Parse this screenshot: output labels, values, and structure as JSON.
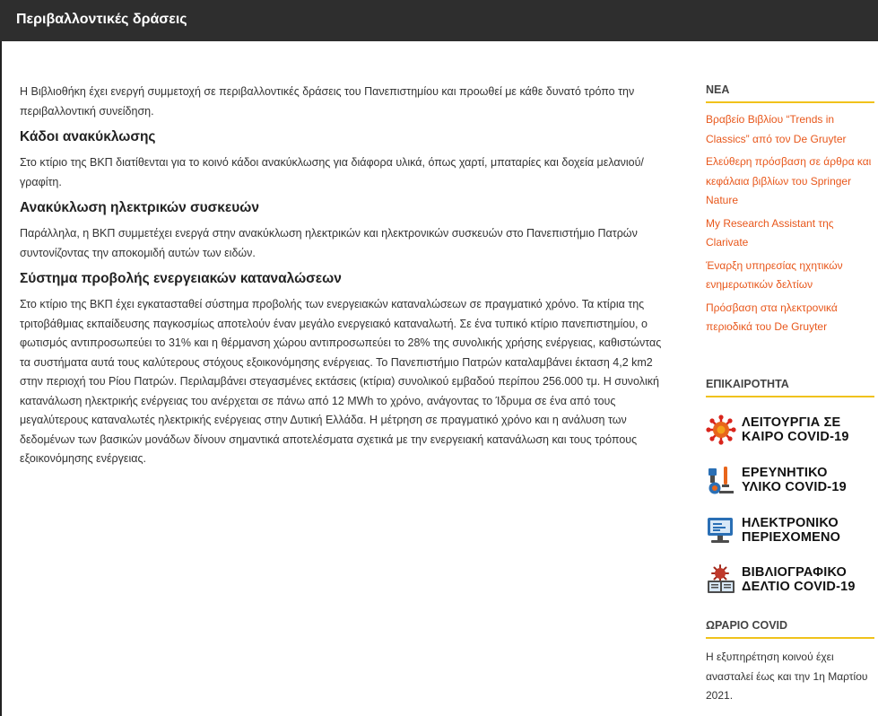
{
  "header": {
    "title": "Περιβαλλοντικές δράσεις"
  },
  "main": {
    "intro": "Η Βιβλιοθήκη έχει ενεργή συμμετοχή σε περιβαλλοντικές δράσεις του Πανεπιστημίου και προωθεί με κάθε δυνατό τρόπο την περιβαλλοντική συνείδηση.",
    "sections": [
      {
        "heading": "Κάδοι ανακύκλωσης",
        "text": "Στο κτίριο της ΒΚΠ διατίθενται για το κοινό κάδοι ανακύκλωσης για διάφορα υλικά, όπως χαρτί, μπαταρίες και δοχεία μελανιού/γραφίτη."
      },
      {
        "heading": "Ανακύκλωση ηλεκτρικών συσκευών",
        "text": "Παράλληλα, η ΒΚΠ συμμετέχει ενεργά στην ανακύκλωση ηλεκτρικών και ηλεκτρονικών συσκευών στο Πανεπιστήμιο Πατρών συντονίζοντας την αποκομιδή αυτών των ειδών."
      },
      {
        "heading": "Σύστημα προβολής ενεργειακών καταναλώσεων",
        "text": "Στο κτίριο της ΒΚΠ έχει εγκατασταθεί σύστημα προβολής των ενεργειακών καταναλώσεων σε πραγματικό χρόνο. Τα κτίρια της τριτοβάθμιας εκπαίδευσης παγκοσμίως αποτελούν έναν μεγάλο ενεργειακό καταναλωτή. Σε ένα τυπικό κτίριο πανεπιστημίου, ο φωτισμός αντιπροσωπεύει το 31% και η θέρμανση χώρου αντιπροσωπεύει το 28% της συνολικής χρήσης ενέργειας, καθιστώντας τα συστήματα αυτά τους καλύτερους στόχους εξοικονόμησης ενέργειας. Το Πανεπιστήμιο Πατρών καταλαμβάνει έκταση 4,2 km2 στην περιοχή του Ρίου Πατρών. Περιλαμβάνει στεγασμένες εκτάσεις (κτίρια) συνολικού εμβαδού περίπου 256.000 τμ. Η συνολική κατανάλωση ηλεκτρικής ενέργειας του ανέρχεται σε πάνω από 12 MWh το χρόνο, ανάγοντας το Ίδρυμα σε ένα από τους μεγαλύτερους καταναλωτές ηλεκτρικής ενέργειας στην Δυτική Ελλάδα. Η μέτρηση σε πραγματικό χρόνο και η ανάλυση των δεδομένων των βασικών μονάδων δίνουν σημαντικά αποτελέσματα σχετικά με την ενεργειακή κατανάλωση και τους τρόπους εξοικονόμησης ενέργειας."
      }
    ]
  },
  "sidebar": {
    "news_heading": "ΝΕΑ",
    "news": [
      "Βραβείο Βιβλίου “Trends in Classics” από τον De Gruyter",
      "Ελεύθερη πρόσβαση σε άρθρα και κεφάλαια βιβλίων του Springer Nature",
      "My Research Assistant της Clarivate",
      "Έναρξη υπηρεσίας ηχητικών ενημερωτικών δελτίων",
      "Πρόσβαση στα ηλεκτρονικά περιοδικά του De Gruyter"
    ],
    "topical_heading": "ΕΠΙΚΑΙΡΟΤΗΤΑ",
    "banners": [
      {
        "line1": "ΛΕΙΤΟΥΡΓΙΑ ΣΕ",
        "line2": "ΚΑΙΡΟ COVID-19",
        "icon": "virus-icon"
      },
      {
        "line1": "ΕΡΕΥΝΗΤΙΚΟ",
        "line2": "ΥΛΙΚΟ COVID-19",
        "icon": "microscope-icon"
      },
      {
        "line1": "ΗΛΕΚΤΡΟΝΙΚΟ",
        "line2": "ΠΕΡΙΕΧΟΜΕΝΟ",
        "icon": "computer-icon"
      },
      {
        "line1": "ΒΙΒΛΙΟΓΡΑΦΙΚΟ",
        "line2": "ΔΕΛΤΙΟ COVID-19",
        "icon": "books-virus-icon"
      }
    ],
    "covid_heading": "ΩΡΑΡΙΟ COVID",
    "covid_text": "Η εξυπηρέτηση κοινού έχει ανασταλεί έως και την 1η Μαρτίου 2021."
  },
  "colors": {
    "header_bg": "#2e2e2e",
    "link": "#e8571b",
    "accent_line": "#f0c21b"
  }
}
